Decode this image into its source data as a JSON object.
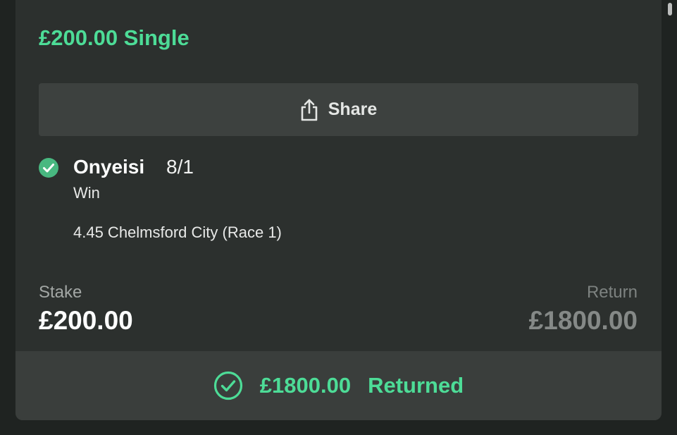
{
  "bet": {
    "title": "£200.00 Single",
    "share_label": "Share",
    "selection": {
      "name": "Onyeisi",
      "odds": "8/1",
      "market": "Win",
      "event": "4.45 Chelmsford City (Race 1)",
      "status_icon": "check-circle-filled-icon"
    },
    "stake": {
      "label": "Stake",
      "value": "£200.00"
    },
    "return": {
      "label": "Return",
      "value": "£1800.00"
    },
    "result": {
      "amount": "£1800.00",
      "status": "Returned",
      "icon": "check-circle-outline-icon"
    }
  },
  "colors": {
    "accent": "#4ddc97",
    "card_bg": "#2c302e",
    "page_bg": "#1f2321",
    "button_bg": "#3d413f"
  }
}
